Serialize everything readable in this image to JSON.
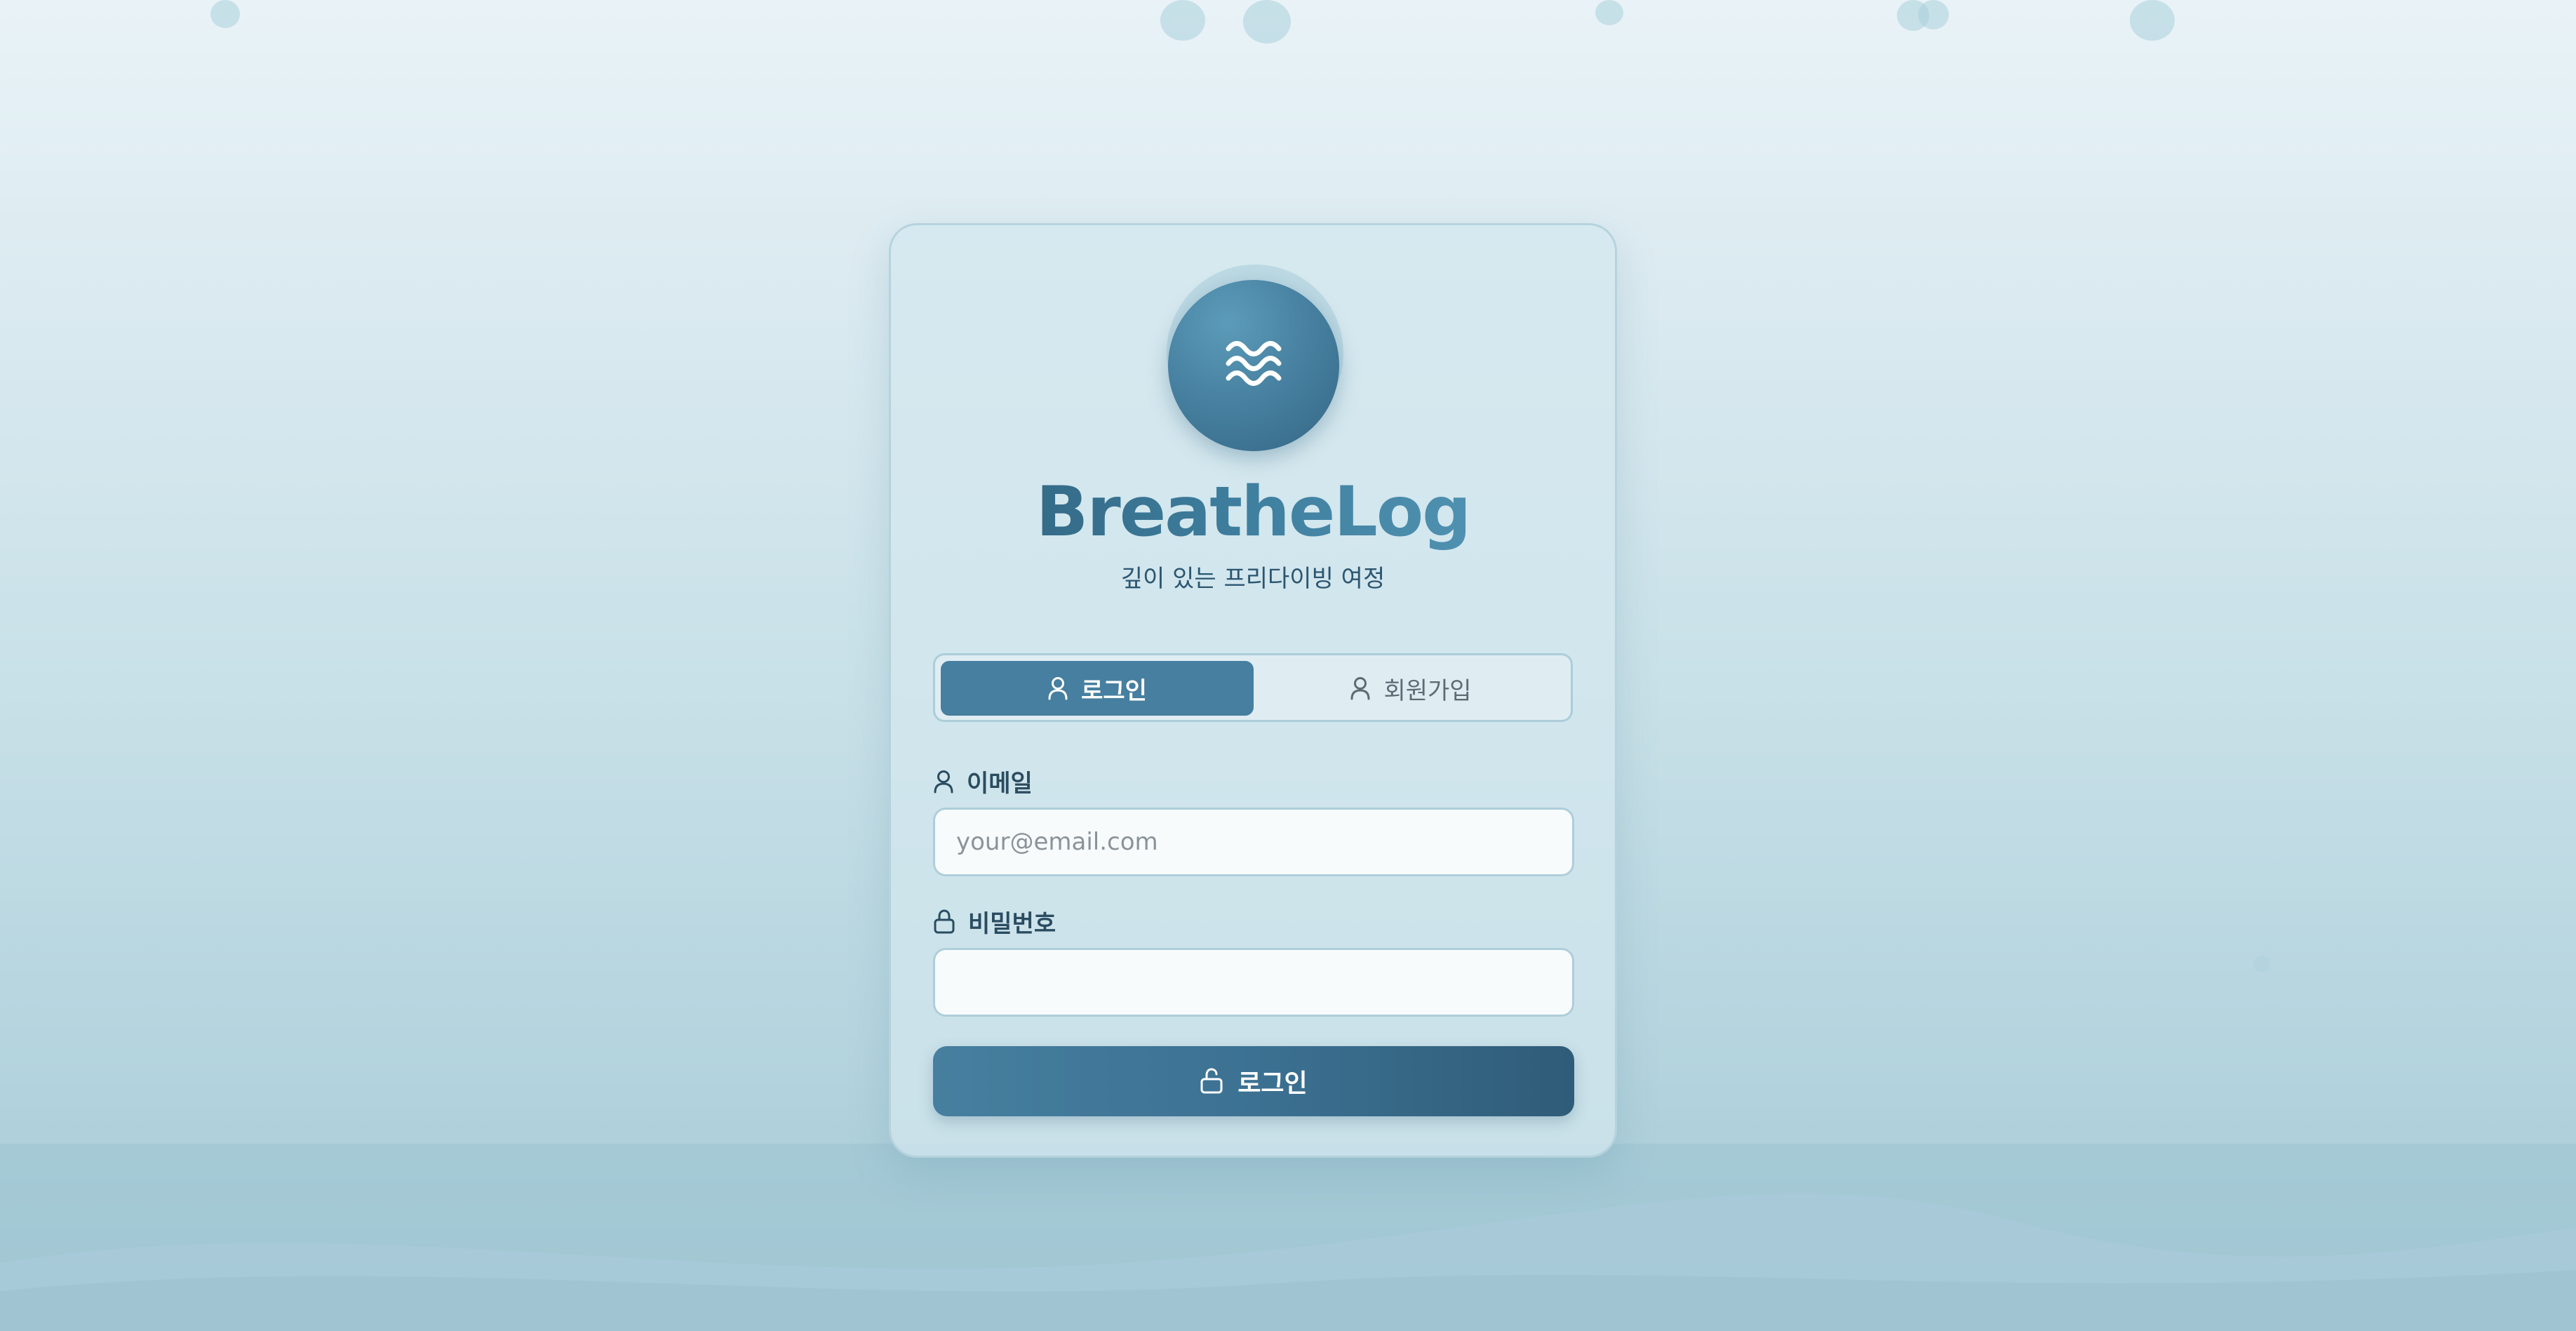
{
  "app": {
    "title": "BreatheLog",
    "subtitle": "깊이 있는 프리다이빙 여정"
  },
  "tabs": [
    {
      "label": "로그인",
      "active": true,
      "icon": "user-icon"
    },
    {
      "label": "회원가입",
      "active": false,
      "icon": "user-icon"
    }
  ],
  "form": {
    "email": {
      "label": "이메일",
      "placeholder": "your@email.com",
      "value": "",
      "icon": "user-icon"
    },
    "password": {
      "label": "비밀번호",
      "placeholder": "",
      "value": "",
      "icon": "lock-icon"
    },
    "submit_label": "로그인",
    "submit_icon": "unlock-icon"
  },
  "colors": {
    "accent": "#467f9f",
    "accent_dark": "#2f5c78",
    "text_dark": "#2b4c60"
  },
  "logo_icon": "waves-icon"
}
